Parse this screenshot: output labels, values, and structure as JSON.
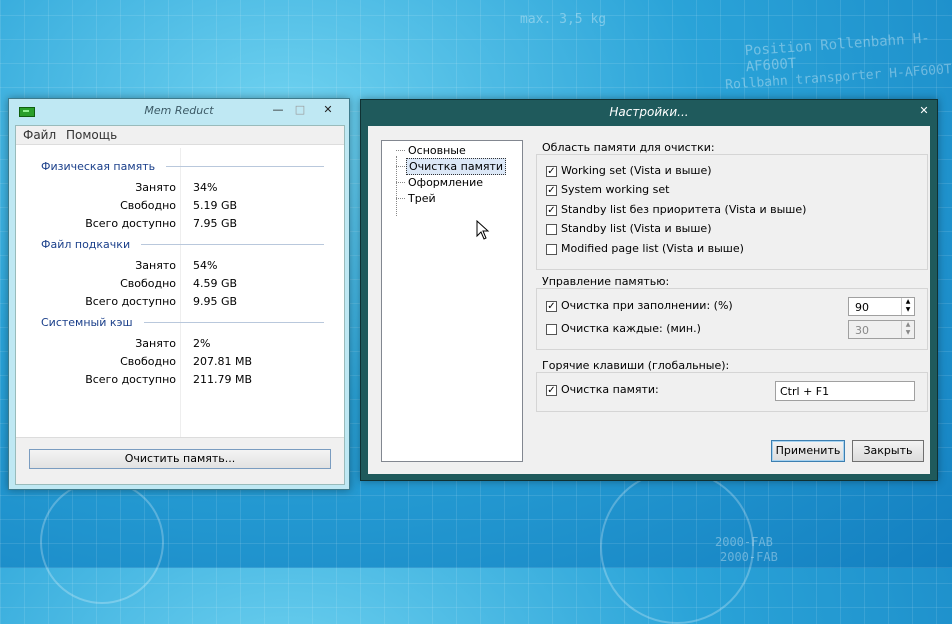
{
  "desktop": {
    "decor_lines": [
      "Position Rollenbahn H-AF600T",
      "Rollbahn transporter H-AF600T",
      "max. 3,5 kg",
      "2000-FAB",
      "2000-FAB"
    ]
  },
  "mem_reduct": {
    "title": "Mem Reduct",
    "window_controls": {
      "minimize": "—",
      "maximize": "□",
      "close": "✕"
    },
    "menu": [
      "Файл",
      "Помощь"
    ],
    "groups": [
      {
        "title": "Физическая память",
        "rows": [
          {
            "label": "Занято",
            "value": "34%"
          },
          {
            "label": "Свободно",
            "value": "5.19 GB"
          },
          {
            "label": "Всего доступно",
            "value": "7.95 GB"
          }
        ]
      },
      {
        "title": "Файл подкачки",
        "rows": [
          {
            "label": "Занято",
            "value": "54%"
          },
          {
            "label": "Свободно",
            "value": "4.59 GB"
          },
          {
            "label": "Всего доступно",
            "value": "9.95 GB"
          }
        ]
      },
      {
        "title": "Системный кэш",
        "rows": [
          {
            "label": "Занято",
            "value": "2%"
          },
          {
            "label": "Свободно",
            "value": "207.81 MB"
          },
          {
            "label": "Всего доступно",
            "value": "211.79 MB"
          }
        ]
      }
    ],
    "clean_button": "Очистить память..."
  },
  "settings": {
    "title": "Настройки...",
    "close": "✕",
    "tree": [
      {
        "label": "Основные",
        "selected": false
      },
      {
        "label": "Очистка памяти",
        "selected": true
      },
      {
        "label": "Оформление",
        "selected": false
      },
      {
        "label": "Трей",
        "selected": false
      }
    ],
    "area_group": {
      "title": "Область памяти для очистки:",
      "options": [
        {
          "label": "Working set (Vista и выше)",
          "checked": true
        },
        {
          "label": "System working set",
          "checked": true
        },
        {
          "label": "Standby list без приоритета (Vista и выше)",
          "checked": true
        },
        {
          "label": "Standby list (Vista и выше)",
          "checked": false
        },
        {
          "label": "Modified page list (Vista и выше)",
          "checked": false
        }
      ]
    },
    "manage_group": {
      "title": "Управление памятью:",
      "fill_label": "Очистка при заполнении: (%)",
      "fill_checked": true,
      "fill_value": "90",
      "every_label": "Очистка каждые: (мин.)",
      "every_checked": false,
      "every_value": "30"
    },
    "hotkeys_group": {
      "title": "Горячие клавиши (глобальные):",
      "clean_label": "Очистка памяти:",
      "clean_checked": true,
      "clean_value": "Ctrl + F1"
    },
    "apply_button": "Применить",
    "close_button": "Закрыть"
  }
}
